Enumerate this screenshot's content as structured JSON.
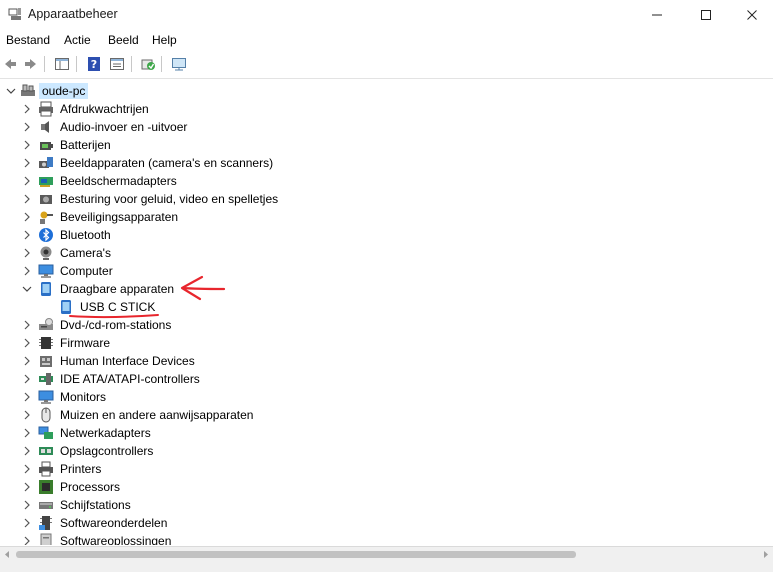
{
  "window": {
    "title": "Apparaatbeheer"
  },
  "menu": [
    "Bestand",
    "Actie",
    "Beeld",
    "Help"
  ],
  "tree": {
    "root": "oude-pc",
    "categories": [
      {
        "label": "Afdrukwachtrijen",
        "icon": "print-queue-icon"
      },
      {
        "label": "Audio-invoer en -uitvoer",
        "icon": "speaker-icon"
      },
      {
        "label": "Batterijen",
        "icon": "battery-icon"
      },
      {
        "label": "Beeldapparaten (camera's en scanners)",
        "icon": "camera-scanner-icon"
      },
      {
        "label": "Beeldschermadapters",
        "icon": "display-adapter-icon"
      },
      {
        "label": "Besturing voor geluid, video en spelletjes",
        "icon": "sound-icon"
      },
      {
        "label": "Beveiligingsapparaten",
        "icon": "security-key-icon"
      },
      {
        "label": "Bluetooth",
        "icon": "bluetooth-icon"
      },
      {
        "label": "Camera's",
        "icon": "webcam-icon"
      },
      {
        "label": "Computer",
        "icon": "computer-icon"
      },
      {
        "label": "Draagbare apparaten",
        "icon": "portable-device-icon",
        "expanded": true,
        "children": [
          "USB C STICK"
        ]
      },
      {
        "label": "Dvd-/cd-rom-stations",
        "icon": "dvd-drive-icon"
      },
      {
        "label": "Firmware",
        "icon": "chip-icon"
      },
      {
        "label": "Human Interface Devices",
        "icon": "hid-icon"
      },
      {
        "label": "IDE ATA/ATAPI-controllers",
        "icon": "ide-controller-icon"
      },
      {
        "label": "Monitors",
        "icon": "monitor-icon"
      },
      {
        "label": "Muizen en andere aanwijsapparaten",
        "icon": "mouse-icon"
      },
      {
        "label": "Netwerkadapters",
        "icon": "network-adapter-icon"
      },
      {
        "label": "Opslagcontrollers",
        "icon": "storage-controller-icon"
      },
      {
        "label": "Printers",
        "icon": "printer-icon"
      },
      {
        "label": "Processors",
        "icon": "processor-icon"
      },
      {
        "label": "Schijfstations",
        "icon": "disk-drive-icon"
      },
      {
        "label": "Softwareonderdelen",
        "icon": "software-component-icon"
      },
      {
        "label": "Softwareoplossingen",
        "icon": "software-icon"
      }
    ]
  },
  "colors": {
    "selection": "#cce8ff",
    "annotation": "#e8262d",
    "accent": "#2a7ad5"
  }
}
